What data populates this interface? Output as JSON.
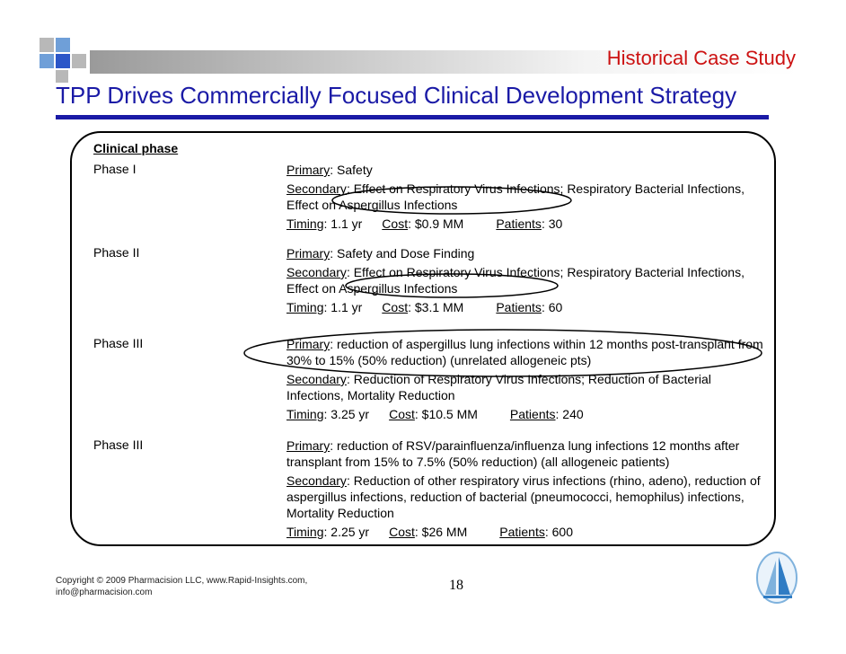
{
  "header": {
    "kicker": "Historical Case Study",
    "title": "TPP Drives Commercially Focused Clinical Development Strategy"
  },
  "table": {
    "column_header": "Clinical phase",
    "phases": [
      {
        "name": "Phase I",
        "primary_label": "Primary",
        "primary_text": ": Safety",
        "secondary_label": "Secondary",
        "secondary_text": ": Effect on Respiratory Virus Infections; Respiratory Bacterial Infections, Effect on Aspergillus Infections",
        "timing_label": "Timing",
        "timing_value": ":  1.1 yr",
        "cost_label": "Cost",
        "cost_value": ":  $0.9 MM",
        "patients_label": "Patients",
        "patients_value": ": 30"
      },
      {
        "name": "Phase II",
        "primary_label": "Primary",
        "primary_text": ": Safety and Dose Finding",
        "secondary_label": "Secondary",
        "secondary_text": ": Effect on Respiratory Virus Infections; Respiratory Bacterial Infections, Effect on Aspergillus Infections",
        "timing_label": "Timing",
        "timing_value": ":  1.1 yr",
        "cost_label": "Cost",
        "cost_value": ":  $3.1 MM",
        "patients_label": "Patients",
        "patients_value": ": 60"
      },
      {
        "name": "Phase III",
        "primary_label": "Primary",
        "primary_text": ": reduction of aspergillus lung infections within 12 months post-transplant from 30% to 15% (50% reduction)    (unrelated allogeneic pts)",
        "secondary_label": "Secondary",
        "secondary_text": ": Reduction of Respiratory Virus Infections; Reduction of Bacterial Infections, Mortality Reduction",
        "timing_label": "Timing",
        "timing_value": ":  3.25 yr",
        "cost_label": "Cost",
        "cost_value": ":  $10.5 MM",
        "patients_label": "Patients",
        "patients_value": ": 240"
      },
      {
        "name": "Phase III",
        "primary_label": "Primary",
        "primary_text": ": reduction of RSV/parainfluenza/influenza lung infections 12 months after transplant from 15% to 7.5% (50% reduction)   (all allogeneic patients)",
        "secondary_label": "Secondary",
        "secondary_text": ": Reduction of other respiratory virus infections (rhino, adeno), reduction of aspergillus infections, reduction of bacterial (pneumococci, hemophilus) infections, Mortality Reduction",
        "timing_label": "Timing",
        "timing_value": ":  2.25 yr",
        "cost_label": "Cost",
        "cost_value": ":  $26 MM",
        "patients_label": "Patients",
        "patients_value": ": 600"
      }
    ]
  },
  "footer": {
    "copyright_line1": "Copyright © 2009 Pharmacision LLC, www.Rapid-Insights.com,",
    "copyright_line2": "info@pharmacision.com",
    "page_number": "18"
  },
  "colors": {
    "title": "#1a1aa6",
    "kicker": "#cc1111",
    "decor_light_blue": "#6f9fd8",
    "decor_dark_blue": "#2b56c8",
    "decor_gray": "#b8b8b8"
  }
}
